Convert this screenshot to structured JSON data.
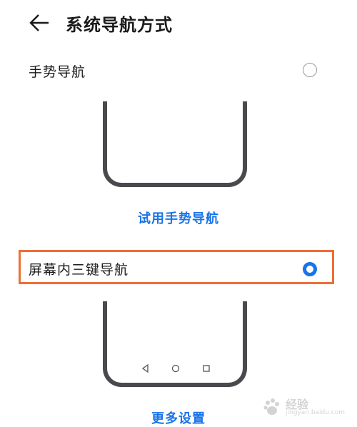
{
  "header": {
    "title": "系统导航方式",
    "back_icon": "arrow-left-icon"
  },
  "options": [
    {
      "label": "手势导航",
      "selected": false,
      "link": "试用手势导航"
    },
    {
      "label": "屏幕内三键导航",
      "selected": true,
      "link": "更多设置"
    }
  ],
  "colors": {
    "accent": "#1a73e8",
    "highlight": "#ee6f33",
    "phone_frame": "#4a4a4e"
  },
  "watermark": {
    "logo": "Bai du",
    "title": "经验",
    "sub": "jingyan.baidu.com"
  }
}
